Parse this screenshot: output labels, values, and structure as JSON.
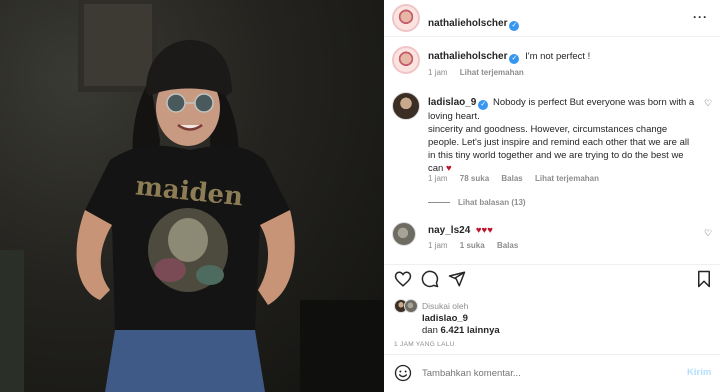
{
  "post": {
    "author": "nathalieholscher",
    "more_label": "···",
    "caption": "I'm not perfect !",
    "caption_time": "1 jam",
    "caption_translate": "Lihat terjemahan"
  },
  "comments": [
    {
      "user": "ladislao_9",
      "text_lines": [
        "Nobody is perfect But everyone was born with a",
        "loving heart.",
        "sincerity and goodness. However, circumstances change",
        "people. Let's just inspire and remind each other that we are all",
        "in this tiny world together and we are trying to do the best we",
        "can"
      ],
      "emoji": "♥",
      "time": "1 jam",
      "likes": "78 suka",
      "reply": "Balas",
      "translate": "Lihat terjemahan",
      "view_replies": "Lihat balasan (13)"
    },
    {
      "user": "nay_ls24",
      "text": "♥♥♥",
      "time": "1 jam",
      "likes": "1 suka",
      "reply": "Balas"
    }
  ],
  "likes": {
    "liked_by_label": "Disukai oleh",
    "liked_by_user": "ladislao_9",
    "and_label": "dan",
    "others": "6.421 lainnya"
  },
  "timestamp": "1 JAM YANG LALU",
  "comment_input": {
    "placeholder": "Tambahkan komentar...",
    "post_label": "Kirim"
  },
  "colors": {
    "verified": "#3797f0",
    "heart_red": "#c0112a",
    "post_disabled": "#b2dffc"
  },
  "icons": [
    "heart-icon",
    "comment-icon",
    "share-icon",
    "bookmark-icon",
    "emoji-icon",
    "more-icon",
    "verified-icon"
  ]
}
